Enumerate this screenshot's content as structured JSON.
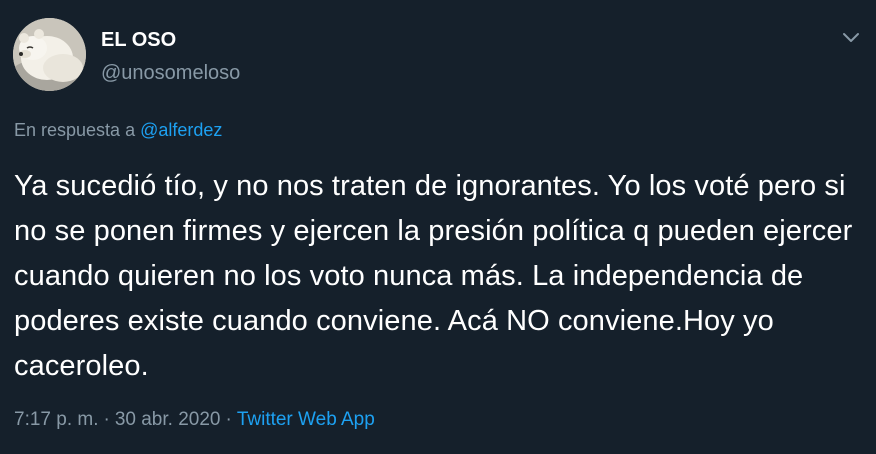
{
  "author": {
    "display_name": "EL OSO",
    "handle": "@unosomeloso",
    "avatar_icon": "polar-bear-avatar"
  },
  "reply": {
    "prefix": "En respuesta a",
    "mention": "@alferdez"
  },
  "tweet": {
    "text": "Ya sucedió tío, y no nos traten de ignorantes. Yo los voté pero si no se ponen firmes y ejercen la presión política q pueden ejercer cuando quieren no los voto nunca más. La independencia de poderes existe cuando conviene. Acá NO conviene.Hoy yo caceroleo."
  },
  "meta": {
    "time": "7:17 p. m.",
    "separator": "·",
    "date": "30 abr. 2020",
    "source": "Twitter Web App"
  },
  "icons": {
    "caret": "chevron-down-icon"
  },
  "colors": {
    "background": "#15202b",
    "text": "#ffffff",
    "secondary": "#8899a6",
    "accent": "#1da1f2"
  }
}
